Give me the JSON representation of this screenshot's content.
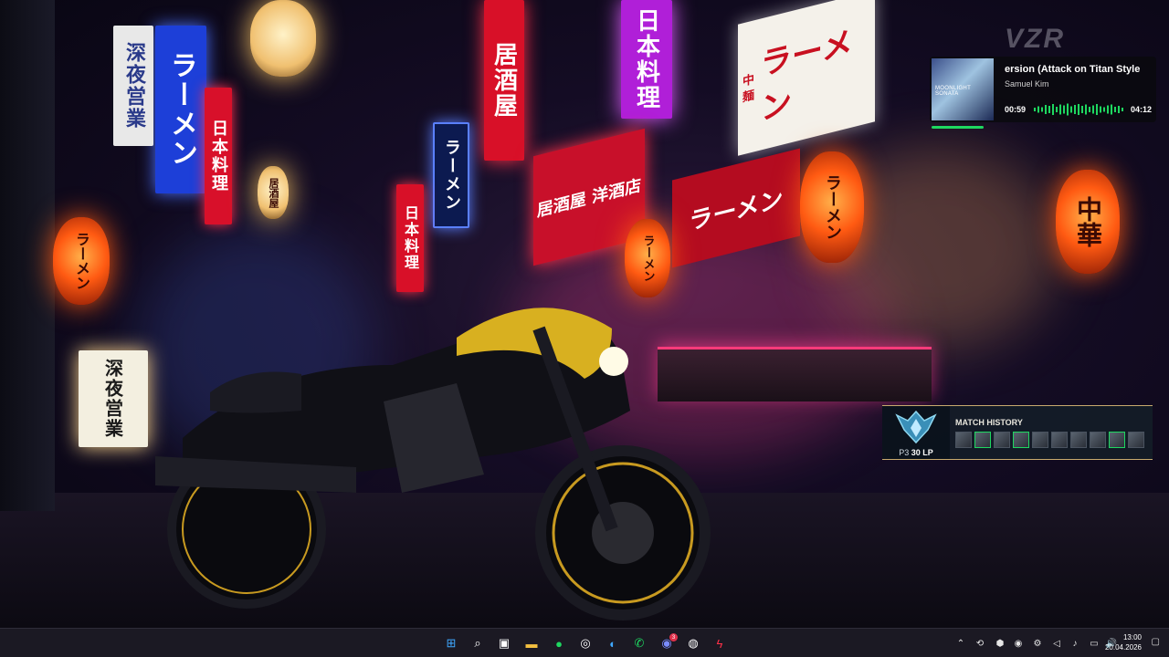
{
  "wallpaper": {
    "signs": {
      "ramen_left": "ラーメン",
      "late_night": "深夜営業",
      "japanese_cuisine": "日本料理",
      "izakaya": "居酒屋",
      "ramen_vertical": "ラーメン",
      "nihon_ryori_top": "日本料理",
      "izakaya_lantern": "居酒屋",
      "ramen_banner": "ラーメン",
      "chuka_lantern": "中華",
      "chuka_men": "中 麺",
      "shop_banner": "居酒屋 洋酒店",
      "brand": "VZR"
    }
  },
  "music_widget": {
    "album_text": "MOONLIGHT SONATA",
    "title": "ersion (Attack on Titan Style",
    "artist": "Samuel Kim",
    "elapsed": "00:59",
    "duration": "04:12",
    "progress": 0.23,
    "accent": "#1ed760"
  },
  "match_widget": {
    "header": "MATCH HISTORY",
    "rank": "P3",
    "lp": "30 LP",
    "results": [
      "loss",
      "win",
      "loss",
      "win",
      "loss",
      "loss",
      "loss",
      "loss",
      "win",
      "loss"
    ],
    "border_color": "#c8aa6e"
  },
  "taskbar": {
    "apps": [
      {
        "name": "windows-start-icon",
        "glyph": "⊞"
      },
      {
        "name": "search-icon",
        "glyph": "⌕"
      },
      {
        "name": "microsoft-store-icon",
        "glyph": "▣"
      },
      {
        "name": "file-explorer-icon",
        "glyph": "▬"
      },
      {
        "name": "spotify-icon",
        "glyph": "●"
      },
      {
        "name": "steam-icon",
        "glyph": "◎"
      },
      {
        "name": "edge-icon",
        "glyph": "◐"
      },
      {
        "name": "whatsapp-icon",
        "glyph": "✆"
      },
      {
        "name": "discord-icon",
        "glyph": "◉"
      },
      {
        "name": "obs-icon",
        "glyph": "◍"
      },
      {
        "name": "app-lightning-icon",
        "glyph": "ϟ"
      }
    ],
    "discord_badge": "3",
    "tray": [
      {
        "name": "chevron-up-icon",
        "glyph": "⌃"
      },
      {
        "name": "tray-app-icon-1",
        "glyph": "⟲"
      },
      {
        "name": "tray-app-icon-2",
        "glyph": "⬢"
      },
      {
        "name": "discord-tray-icon",
        "glyph": "◉"
      },
      {
        "name": "tray-app-icon-3",
        "glyph": "⚙"
      },
      {
        "name": "volume-tray-icon",
        "glyph": "◁"
      },
      {
        "name": "microphone-icon",
        "glyph": "♪"
      },
      {
        "name": "network-icon",
        "glyph": "▭"
      },
      {
        "name": "speaker-icon",
        "glyph": "🔊"
      }
    ],
    "time": "13:00",
    "date": "20.04.2026",
    "notification_glyph": "▢"
  }
}
